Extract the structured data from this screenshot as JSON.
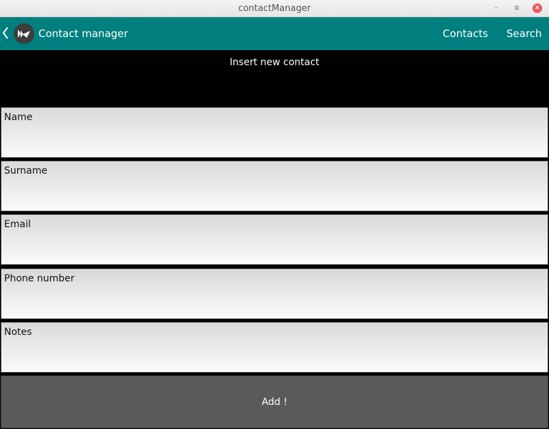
{
  "window": {
    "title": "contactManager"
  },
  "actionbar": {
    "title": "Contact manager",
    "nav": [
      "Contacts",
      "Search"
    ]
  },
  "form": {
    "header": "Insert new contact",
    "fields": [
      {
        "placeholder": "Name"
      },
      {
        "placeholder": "Surname"
      },
      {
        "placeholder": "Email"
      },
      {
        "placeholder": "Phone number"
      },
      {
        "placeholder": "Notes"
      }
    ],
    "submit_label": "Add !"
  },
  "colors": {
    "actionbar": "#007f7f",
    "background": "#000000",
    "button": "#5a5a5a",
    "close": "#e9595d"
  },
  "icons": [
    "back-arrow-icon",
    "kivy-logo-icon",
    "minimize-icon",
    "restore-icon",
    "close-icon"
  ]
}
